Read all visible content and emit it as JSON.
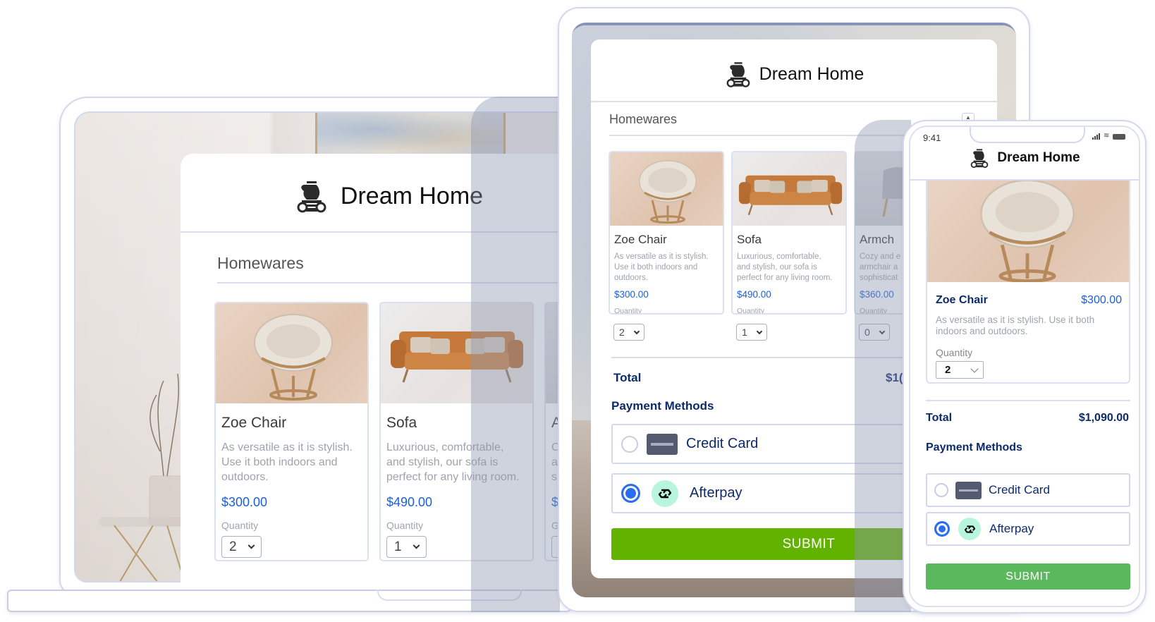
{
  "app": {
    "brand_name": "Dream Home",
    "brand_icon": "vase-on-pedestal-icon"
  },
  "form": {
    "section_title": "Homewares",
    "products": [
      {
        "name": "Zoe Chair",
        "description": "As versatile as it is stylish. Use it both indoors and outdoors.",
        "price": "$300.00",
        "quantity_label": "Quantity",
        "quantity": "2",
        "image": "papasan-chair"
      },
      {
        "name": "Sofa",
        "description": "Luxurious, comfortable, and stylish, our sofa is perfect for any living room.",
        "price": "$490.00",
        "quantity_label": "Quantity",
        "quantity": "1",
        "image": "leather-sofa"
      },
      {
        "name": "Armchair",
        "name_visible": "Armch",
        "description_visible": [
          "Cozy and e",
          "armchair a",
          "sophisticat"
        ],
        "price": "$360.00",
        "quantity_label": "Quantity",
        "quantity": "0",
        "image": "grey-armchair"
      }
    ],
    "total_label": "Total",
    "total_value": "$1,090.00",
    "total_value_truncated": "$1(",
    "payment_methods_title": "Payment Methods",
    "payment_methods": [
      {
        "label": "Credit Card",
        "icon": "credit-card-icon",
        "selected": false
      },
      {
        "label": "Afterpay",
        "icon": "afterpay-icon",
        "selected": true
      }
    ],
    "submit_label": "SUBMIT"
  },
  "laptop": {
    "title": "Dream Home",
    "section": "Homewares",
    "cards": [
      {
        "name": "Zoe Chair",
        "desc_lines": [
          "As versatile as it is stylish.",
          "Use it both indoors and",
          "outdoors."
        ],
        "price": "$300.00",
        "qty_label": "Quantity",
        "qty": "2"
      },
      {
        "name": "Sofa",
        "desc_lines": [
          "Luxurious, comfortable,",
          "and stylish, our sofa is",
          "perfect for any living room."
        ],
        "price": "$490.00",
        "qty_label": "Quantity",
        "qty": "1"
      },
      {
        "name": "A",
        "desc_lines": [
          "C",
          "a",
          "s"
        ],
        "price": "$",
        "qty_label": "G"
      }
    ]
  },
  "tablet": {
    "title": "Dream Home",
    "section": "Homewares",
    "cards": [
      {
        "name": "Zoe Chair",
        "desc_lines": [
          "As versatile as it is stylish.",
          "Use it both indoors and",
          "outdoors."
        ],
        "price": "$300.00",
        "qty_label": "Quantity",
        "qty": "2"
      },
      {
        "name": "Sofa",
        "desc_lines": [
          "Luxurious, comfortable,",
          "and stylish, our sofa is",
          "perfect for any living room."
        ],
        "price": "$490.00",
        "qty_label": "Quantity",
        "qty": "1"
      },
      {
        "name": "Armch",
        "desc_lines": [
          "Cozy and e",
          "armchair a",
          "sophisticat"
        ],
        "price": "$360.00",
        "qty_label": "Quantity",
        "qty": "0"
      }
    ],
    "total_label": "Total",
    "total_value": "$1(",
    "pm_title": "Payment Methods",
    "pm": [
      "Credit Card",
      "Afterpay"
    ],
    "submit": "SUBMIT"
  },
  "phone": {
    "status_time": "9:41",
    "title": "Dream Home",
    "card": {
      "name": "Zoe Chair",
      "price": "$300.00",
      "desc_lines": [
        "As versatile as it is stylish. Use it both",
        "indoors and outdoors."
      ],
      "qty_label": "Quantity",
      "qty": "2"
    },
    "total_label": "Total",
    "total_value": "$1,090.00",
    "pm_title": "Payment Methods",
    "pm": [
      "Credit Card",
      "Afterpay"
    ],
    "submit": "SUBMIT"
  },
  "colors": {
    "price_blue": "#1a5fdc",
    "navy_text": "#0d2a6b",
    "radio_selected": "#2a6ef0",
    "submit_tablet": "#62b300",
    "submit_phone": "#5cb85c",
    "afterpay_mint": "#b7f5de",
    "frame_border": "#d4d8ec"
  }
}
